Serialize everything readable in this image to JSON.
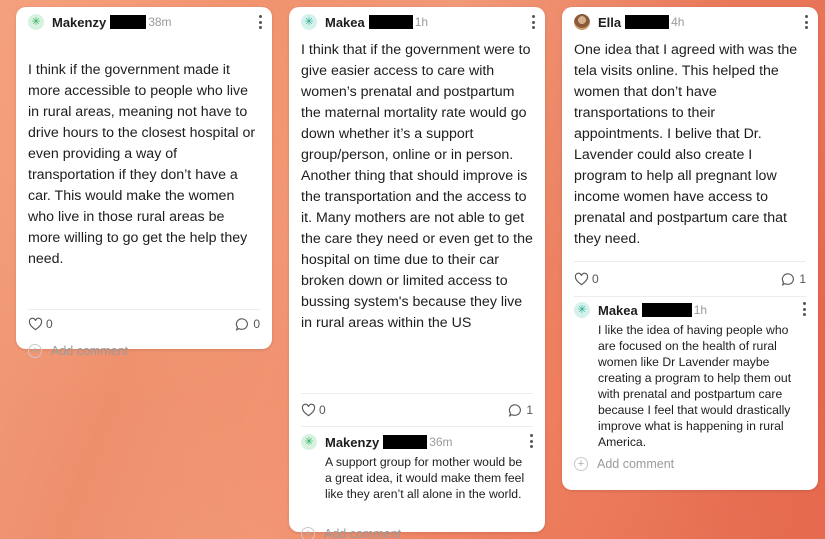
{
  "cards": [
    {
      "author": "Makenzy",
      "time": "38m",
      "text": "I think if the government made it more accessible to people who live in rural areas, meaning not have to drive hours to the closest hospital or even providing a way of transportation if they don’t have a car. This would make the women who live in those rural areas be more willing to go get the help they need.",
      "likes": "0",
      "comments_count": "0",
      "add_comment_label": "Add comment"
    },
    {
      "author": "Makea",
      "time": "1h",
      "text": "I think that if the government were to give easier access to care with women’s prenatal and postpartum the maternal mortality rate would go down whether it’s a support group/person, online or in person. Another thing that should improve is the transportation and the access to it. Many mothers are not able to get the care they need or even get to the hospital on time due to their car broken down or limited access to bussing system's because they live in rural areas within the US",
      "likes": "0",
      "comments_count": "1",
      "comment": {
        "author": "Makenzy",
        "time": "36m",
        "text": "A support group for mother would be a great idea, it would make them feel like they aren’t all alone in the world."
      },
      "add_comment_label": "Add comment"
    },
    {
      "author": "Ella",
      "time": "4h",
      "text": "One idea that I agreed with was the tela visits online. This helped the women that don’t have transportations to their appointments. I belive that Dr. Lavender could also create I program to help all pregnant low income women have access to prenatal and postpartum care that they need.",
      "likes": "0",
      "comments_count": "1",
      "comment": {
        "author": "Makea",
        "time": "1h",
        "text": "I like the idea of having people who are focused on the health of rural women like Dr Lavender maybe creating a program to help them out with prenatal and postpartum care because I feel that would drastically improve what is happening in rural America."
      },
      "add_comment_label": "Add comment"
    }
  ],
  "icons": {
    "avatar_leaf": "✳",
    "like": "heart-icon",
    "comment": "comment-icon",
    "menu": "more-vertical-icon",
    "add": "plus-icon"
  }
}
